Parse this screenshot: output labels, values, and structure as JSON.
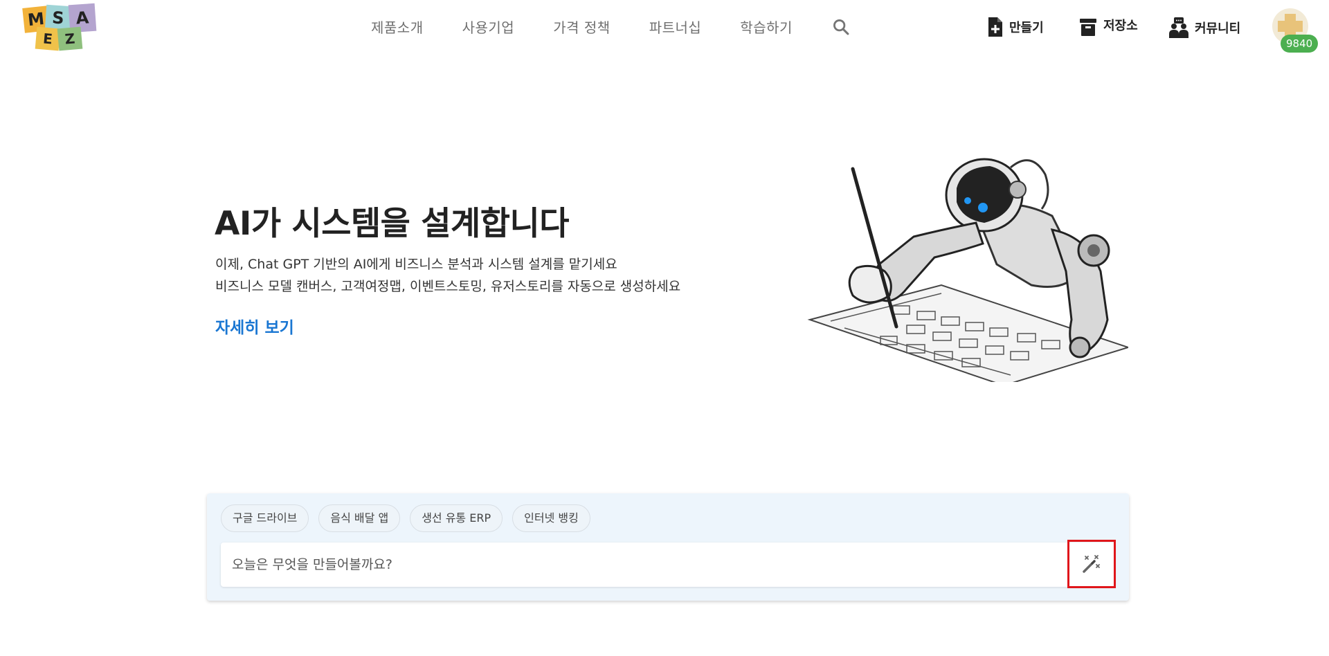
{
  "header": {
    "logo": {
      "letters": [
        "M",
        "S",
        "A",
        "E",
        "Z"
      ],
      "alt": "MSA EZ"
    },
    "nav": [
      {
        "label": "제품소개"
      },
      {
        "label": "사용기업"
      },
      {
        "label": "가격 정책"
      },
      {
        "label": "파트너십"
      },
      {
        "label": "학습하기"
      }
    ],
    "actions": {
      "create_label": "만들기",
      "storage_label": "저장소",
      "community_label": "커뮤니티"
    },
    "credits": "9840"
  },
  "hero": {
    "title": "AI가 시스템을 설계합니다",
    "line1": "이제, Chat GPT 기반의 AI에게 비즈니스 분석과 시스템 설계를 맡기세요",
    "line2": "비즈니스 모델 캔버스, 고객여정맵, 이벤트스토밍, 유저스토리를 자동으로 생성하세요",
    "more_link": "자세히 보기"
  },
  "prompt": {
    "chips": [
      {
        "label": "구글 드라이브"
      },
      {
        "label": "음식 배달 앱"
      },
      {
        "label": "생선 유통 ERP"
      },
      {
        "label": "인터넷 뱅킹"
      }
    ],
    "placeholder": "오늘은 무엇을 만들어볼까요?"
  },
  "colors": {
    "accent": "#1976d2",
    "badge": "#4caf50",
    "panel_bg": "#edf5fc",
    "highlight": "#e0161b"
  }
}
